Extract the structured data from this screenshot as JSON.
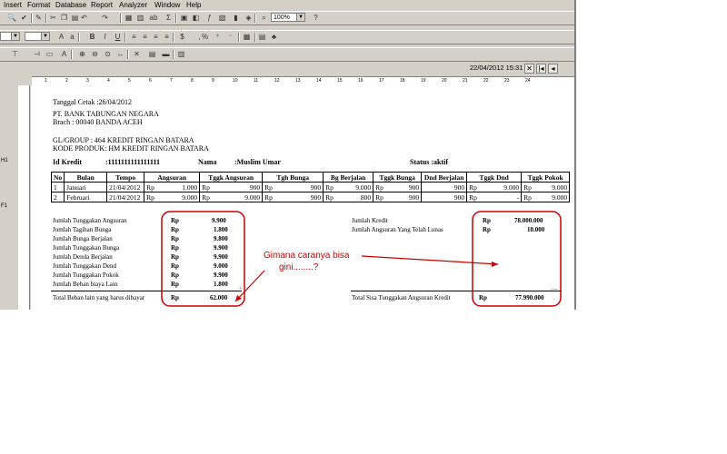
{
  "menu": [
    "Insert",
    "Format",
    "Database",
    "Report",
    "Analyzer",
    "Window",
    "Help"
  ],
  "toolbar": {
    "zoom_value": "100%",
    "datetime": "22/04/2012  15:31",
    "sigma": "Σ",
    "ab": "ab"
  },
  "ruler": [
    "1",
    "2",
    "3",
    "4",
    "5",
    "6",
    "7",
    "8",
    "9",
    "10",
    "11",
    "12",
    "13",
    "14",
    "15",
    "16",
    "17",
    "18",
    "19",
    "20",
    "21",
    "22",
    "23",
    "24"
  ],
  "left_labels": [
    "H1",
    "F1"
  ],
  "report": {
    "print_date": "Tanggal Cetak :26/04/2012",
    "bank": "PT. BANK TABUNGAN NEGARA",
    "branch": "Brach   : 00040     BANDA ACEH",
    "group": "GL/GROUP       : 464 KREDIT RINGAN BATARA",
    "product": "KODE PRODUK:  HM KREDIT RINGAN BATARA",
    "id_label": "Id Kredit",
    "id_value": ":1111111111111111",
    "name_label": "Nama",
    "name_value": ":Muslim Umar",
    "status": "Status :aktif",
    "table": {
      "headers": [
        "No",
        "Bulan",
        "Tempo",
        "Angsuran",
        "",
        "Tggk Angsuran",
        "",
        "Tgh Bunga",
        "",
        "Bg Berjalan",
        "",
        "Tggk Bunga",
        "",
        "Dnd  Berjalan",
        "Tggk Dnd",
        "",
        "Tggk Pokok",
        ""
      ],
      "rows": [
        [
          "1",
          "Januari",
          "21/04/2012",
          "Rp",
          "1.000",
          "Rp",
          "900",
          "Rp",
          "900",
          "Rp",
          "9.000",
          "Rp",
          "900",
          "900",
          "Rp",
          "9.000",
          "Rp",
          "9.000"
        ],
        [
          "2",
          "Februari",
          "21/04/2012",
          "Rp",
          "9.000",
          "Rp",
          "9.000",
          "Rp",
          "900",
          "Rp",
          "800",
          "Rp",
          "900",
          "900",
          "Rp",
          "-",
          "Rp",
          "9.000"
        ]
      ]
    },
    "summary_left": [
      {
        "label": "Jumlah Tunggakan Angsuran",
        "cur": "Rp",
        "val": "9.900"
      },
      {
        "label": "Jumlah Tagihan Bunga",
        "cur": "Rp",
        "val": "1.800"
      },
      {
        "label": "Jumlah Bunga Berjalan",
        "cur": "Rp",
        "val": "9.800"
      },
      {
        "label": "Jumlah Tunggakan Bunga",
        "cur": "Rp",
        "val": "9.900"
      },
      {
        "label": "Jumlah Denda Berjalan",
        "cur": "Rp",
        "val": "9.900"
      },
      {
        "label": "Jumlah Tunggakan Dend",
        "cur": "Rp",
        "val": "9.000"
      },
      {
        "label": "Jumlah Tunggakan Pokok",
        "cur": "Rp",
        "val": "9.900"
      },
      {
        "label": "Jumlah Beban biaya Lain",
        "cur": "Rp",
        "val": "1.800"
      }
    ],
    "total_left": {
      "label": "Total Beban lain yang harus dibayar",
      "cur": "Rp",
      "val": "62.000"
    },
    "summary_right": [
      {
        "label": "Jumlah Kredit",
        "cur": "Rp",
        "val": "78.000.000"
      },
      {
        "label": "Jumlah Angsuran Yang Telah Lunas",
        "cur": "Rp",
        "val": "10.000"
      }
    ],
    "total_right": {
      "label": "Total Sisa Tunggakan Angsuran Kredit",
      "cur": "Rp",
      "val": "77.990.000"
    }
  },
  "annotation": {
    "line1": "Gimana caranya bisa",
    "line2": "gini........?",
    "color": "#cc0000"
  }
}
